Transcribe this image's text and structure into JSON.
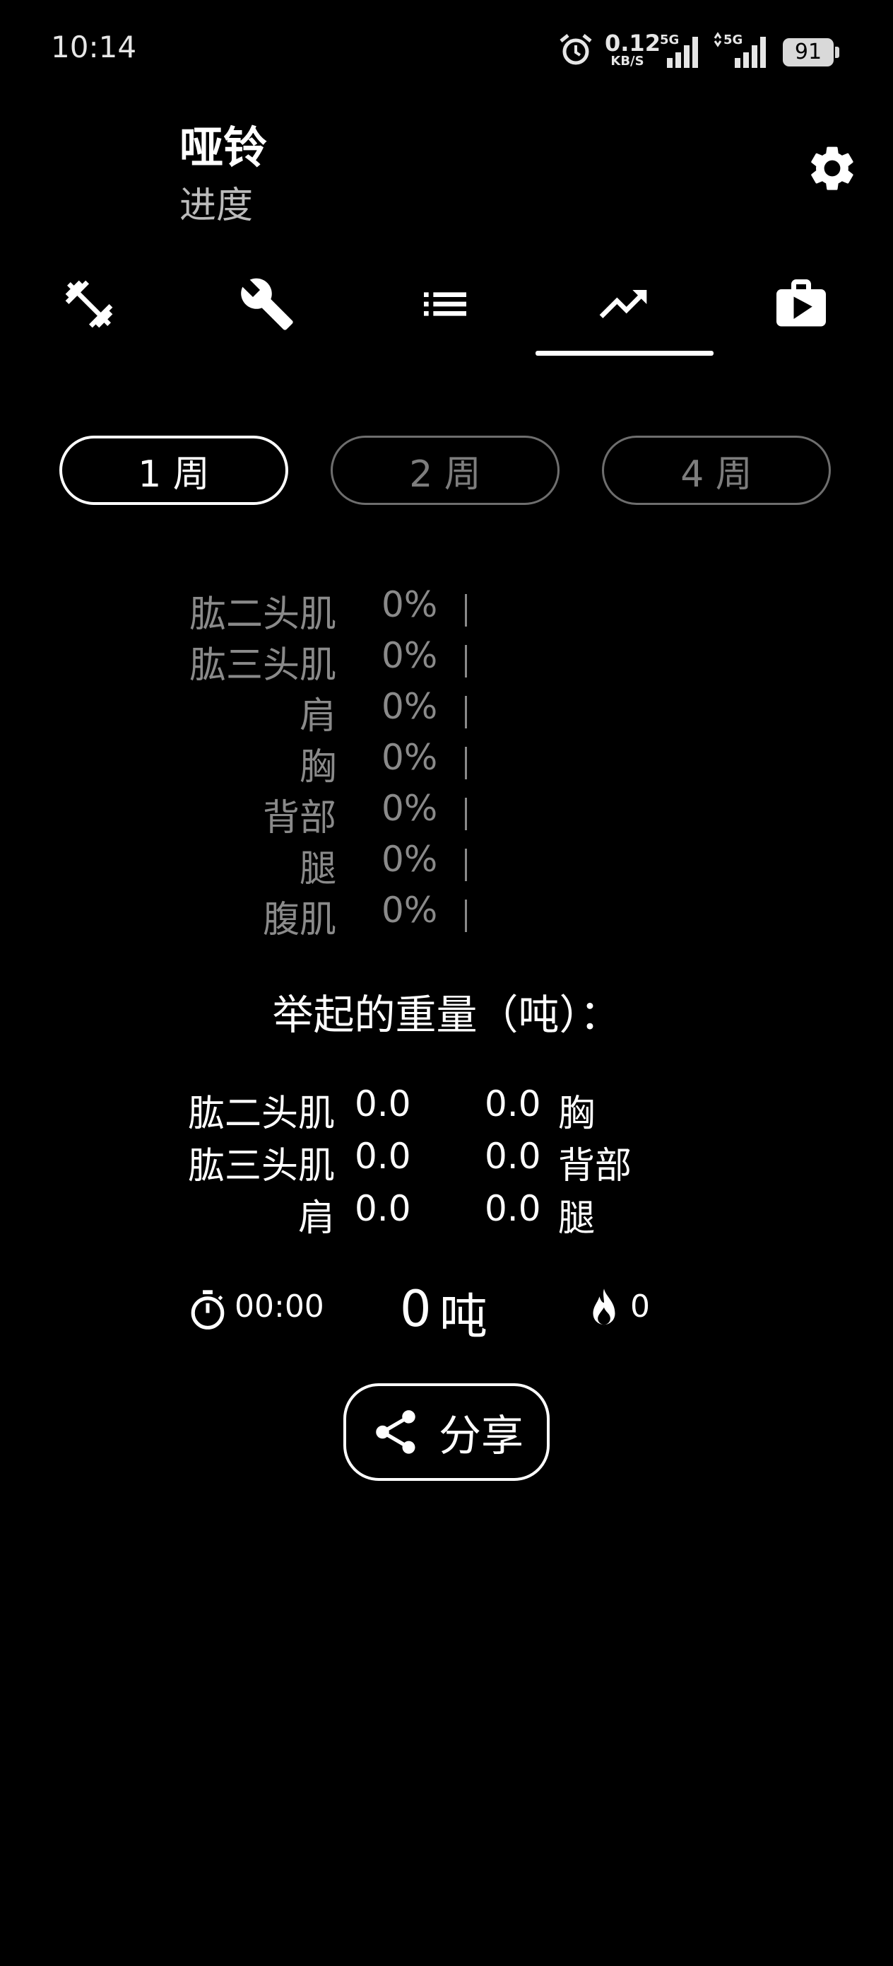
{
  "status_bar": {
    "time": "10:14",
    "net_speed": "0.12",
    "net_unit": "KB/S",
    "battery": "91"
  },
  "header": {
    "title": "哑铃",
    "subtitle": "进度"
  },
  "tabs": [
    {
      "icon": "dumbbell-icon",
      "active": false
    },
    {
      "icon": "wrench-icon",
      "active": false
    },
    {
      "icon": "list-icon",
      "active": false
    },
    {
      "icon": "trending-up-icon",
      "active": true
    },
    {
      "icon": "store-icon",
      "active": false
    }
  ],
  "periods": [
    {
      "label": "1 周",
      "active": true
    },
    {
      "label": "2 周",
      "active": false
    },
    {
      "label": "4 周",
      "active": false
    }
  ],
  "muscle_progress": [
    {
      "name": "肱二头肌",
      "percent": "0%",
      "value": 0
    },
    {
      "name": "肱三头肌",
      "percent": "0%",
      "value": 0
    },
    {
      "name": "肩",
      "percent": "0%",
      "value": 0
    },
    {
      "name": "胸",
      "percent": "0%",
      "value": 0
    },
    {
      "name": "背部",
      "percent": "0%",
      "value": 0
    },
    {
      "name": "腿",
      "percent": "0%",
      "value": 0
    },
    {
      "name": "腹肌",
      "percent": "0%",
      "value": 0
    }
  ],
  "weight_lifted": {
    "title": "举起的重量（吨）：",
    "left": [
      {
        "name": "肱二头肌",
        "value": "0.0"
      },
      {
        "name": "肱三头肌",
        "value": "0.0"
      },
      {
        "name": "肩",
        "value": "0.0"
      }
    ],
    "right": [
      {
        "name": "胸",
        "value": "0.0"
      },
      {
        "name": "背部",
        "value": "0.0"
      },
      {
        "name": "腿",
        "value": "0.0"
      }
    ]
  },
  "summary": {
    "duration": "00:00",
    "total_tons": "0",
    "tons_unit": "吨",
    "calories": "0"
  },
  "share": {
    "label": "分享"
  },
  "colors": {
    "background": "#000000",
    "foreground": "#ffffff",
    "muted": "#8a8a8a"
  }
}
